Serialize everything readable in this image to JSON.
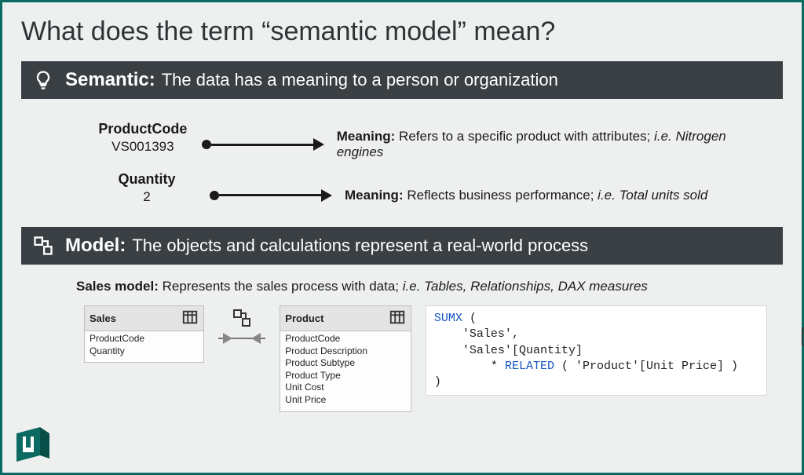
{
  "title": "What does the term “semantic model” mean?",
  "semantic": {
    "label": "Semantic:",
    "desc": "The data has a meaning to a person or organization",
    "examples": [
      {
        "field": "ProductCode",
        "value": "VS001393",
        "meaning_label": "Meaning:",
        "meaning_text": " Refers to a specific product with attributes; ",
        "meaning_italic": "i.e. Nitrogen engines"
      },
      {
        "field": "Quantity",
        "value": "2",
        "meaning_label": "Meaning:",
        "meaning_text": " Reflects business performance; ",
        "meaning_italic": "i.e. Total units sold"
      }
    ]
  },
  "model": {
    "label": "Model:",
    "desc": "The objects and calculations represent a real-world process",
    "sales_label": "Sales model:",
    "sales_text": " Represents the sales process with data; ",
    "sales_italic": "i.e. Tables, Relationships, DAX measures"
  },
  "tables": {
    "sales": {
      "name": "Sales",
      "columns": [
        "ProductCode",
        "Quantity"
      ]
    },
    "product": {
      "name": "Product",
      "columns": [
        "ProductCode",
        "Product Description",
        "Product Subtype",
        "Product Type",
        "Unit Cost",
        "Unit Price"
      ]
    }
  },
  "dax": {
    "kw1": "SUMX",
    "open": " (",
    "line2": "    'Sales',",
    "line3a": "    'Sales'[Quantity]",
    "line4a": "        * ",
    "kw2": "RELATED",
    "line4b": " ( 'Product'[Unit Price] )",
    "close": ")"
  }
}
